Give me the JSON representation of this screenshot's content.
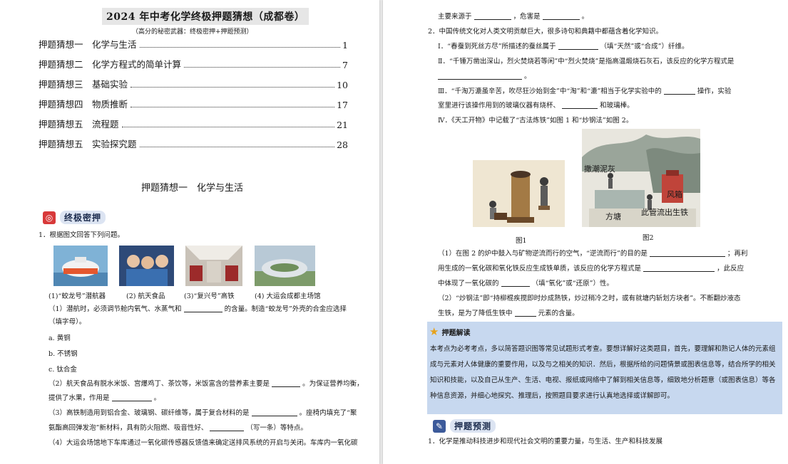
{
  "left_page": {
    "title": "2024 年中考化学终极押题猜想（成都卷）",
    "subtitle": "（高分的秘密武器：终极密押+押题预测）",
    "toc": [
      {
        "num": "押题猜想一",
        "topic": "化学与生活",
        "page": "1"
      },
      {
        "num": "押题猜想二",
        "topic": "化学方程式的简单计算",
        "page": "7"
      },
      {
        "num": "押题猜想三",
        "topic": "基础实验",
        "page": "10"
      },
      {
        "num": "押题猜想四",
        "topic": "物质推断",
        "page": "17"
      },
      {
        "num": "押题猜想五",
        "topic": "流程题",
        "page": "21"
      },
      {
        "num": "押题猜想五",
        "topic": "实验探究题",
        "page": "28"
      }
    ],
    "section_heading": "押题猜想一　化学与生活",
    "banner_label": "终极密押",
    "q1_intro": "1．根据图文回答下列问题。",
    "images": [
      {
        "caption": "(1)“蛟龙号”潜航器"
      },
      {
        "caption": "(2)  航天食品"
      },
      {
        "caption": "(3)“复兴号”高铁"
      },
      {
        "caption": "(4)  大运会成都主场馆"
      }
    ],
    "q1_1_a": "（1）潜航时，必须调节舱内氧气、水蒸气和",
    "q1_1_b": "的含量。制造“蛟龙号”外壳的合金应选择",
    "q1_1_c": "（填字母）。",
    "options": [
      "a.  黄铜",
      "b.  不锈钢",
      "c.  钛合金"
    ],
    "q1_2_a": "（2）航天食品有脱水米饭、宫爆鸡丁、茶饮等，米饭富含的营养素主要是",
    "q1_2_b": "。为保证营养均衡，",
    "q1_2_c": "提供了水果，作用是",
    "q1_2_d": "。",
    "q1_3_a": "（3）高铁制造用到铝合金、玻璃钢、碳纤维等，属于复合材料的是",
    "q1_3_b": "。座椅内填充了“聚",
    "q1_3_c": "氨酯高回弹发泡”新材料，具有防火阻燃、吸音性好、",
    "q1_3_d": "（写一条）等特点。",
    "q1_4": "（4）大运会场馆地下车库通过一氧化碳传感器反馈值来确定送排风系统的开启与关闭。车库内一氧化碳"
  },
  "right_page": {
    "line1_a": "主要来源于",
    "line1_b": "，危害是",
    "line1_c": "。",
    "q2_intro": "2．中国传统文化对人类文明贡献巨大，很多诗句和典籍中都蕴含着化学知识。",
    "q2_i_a": "Ⅰ．“春蚕到死丝方尽”所描述的蚕丝属于",
    "q2_i_b": "（填“天然”或“合成”）纤维。",
    "q2_ii_a": "Ⅱ．“千锤万凿出深山，烈火焚烧若等闲”中“烈火焚烧”是指高温煅烧石灰石，该反应的化学方程式是",
    "q2_ii_b": "。",
    "q2_iii_a": "Ⅲ．“千淘万漉虽辛苦，吹尽狂沙始到金”中“淘”和“漉”相当于化学实验中的",
    "q2_iii_b": "操作，实验",
    "q2_iii_c": "室里进行该操作用到的玻璃仪器有烧杯、",
    "q2_iii_d": "和玻璃棒。",
    "q2_iv": "Ⅳ．《天工开物》中记载了“古法炼铁”如图 1 和“炒钢法”如图 2。",
    "fig1_label": "图1",
    "fig2_label": "图2",
    "fig2_annotations": [
      "撒潮泥灰",
      "风箱",
      "方塘",
      "此管流出生铁"
    ],
    "p1_a": "（1）在图 2 的炉中鼓入与矿物逆流而行的空气，“逆流而行”的目的是",
    "p1_b": "；再利",
    "p1_c": "用生成的一氧化碳和氧化铁反应生成铁单质，该反应的化学方程式是",
    "p1_d": "，此反应",
    "p1_e": "中体现了一氧化碳的",
    "p1_f": "（填“氧化”或“还原”）性。",
    "p2_a": "（2）“炒钢法”即“持柳棍疾搅即时炒成熟铁，炒过稍冷之时，或有就塘内斩划方块者”。不断翻炒液态",
    "p2_b": "生铁，是为了降低生铁中",
    "p2_c": "元素的含量。",
    "analysis_title": "押题解读",
    "analysis_text": "本考点为必考考点，多以简答题识图等常见试题形式考查。要想详解好这类题目，首先，要理解和熟记人体的元素组成与元素对人体健康的重要作用，以及与之相关的知识．然后，根据所给的问题情景或图表信息等，结合所学的相关知识和技能，以及自己从生产、生活、电视、报纸或网络中了解到相关信息等，细致地分析题意（或图表信息）等各种信息资源，并细心地探究、推理后，按照题目要求进行认真地选择或详解即可。",
    "predict_label": "押题预测",
    "q_last": "1．化学是推动科技进步和现代社会文明的重要力量，与生活、生产和科技发展"
  }
}
